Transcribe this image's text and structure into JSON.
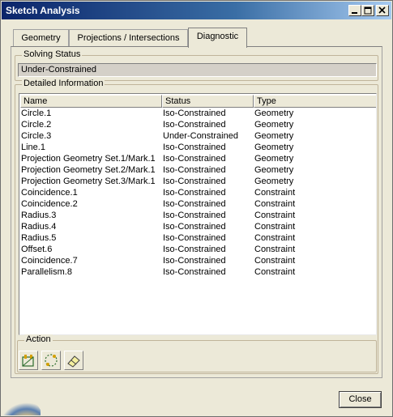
{
  "window": {
    "title": "Sketch Analysis"
  },
  "titlebar_buttons": [
    "minimize-icon",
    "maximize-icon",
    "close-icon"
  ],
  "tabs": [
    {
      "label": "Geometry"
    },
    {
      "label": "Projections / Intersections"
    },
    {
      "label": "Diagnostic"
    }
  ],
  "active_tab": "Diagnostic",
  "solving_status": {
    "label": "Solving Status",
    "value": "Under-Constrained"
  },
  "detailed_info": {
    "label": "Detailed Information",
    "columns": [
      "Name",
      "Status",
      "Type"
    ],
    "rows": [
      [
        "Circle.1",
        "Iso-Constrained",
        "Geometry"
      ],
      [
        "Circle.2",
        "Iso-Constrained",
        "Geometry"
      ],
      [
        "Circle.3",
        "Under-Constrained",
        "Geometry"
      ],
      [
        "Line.1",
        "Iso-Constrained",
        "Geometry"
      ],
      [
        "Projection Geometry Set.1/Mark.1",
        "Iso-Constrained",
        "Geometry"
      ],
      [
        "Projection Geometry Set.2/Mark.1",
        "Iso-Constrained",
        "Geometry"
      ],
      [
        "Projection Geometry Set.3/Mark.1",
        "Iso-Constrained",
        "Geometry"
      ],
      [
        "Coincidence.1",
        "Iso-Constrained",
        "Constraint"
      ],
      [
        "Coincidence.2",
        "Iso-Constrained",
        "Constraint"
      ],
      [
        "Radius.3",
        "Iso-Constrained",
        "Constraint"
      ],
      [
        "Radius.4",
        "Iso-Constrained",
        "Constraint"
      ],
      [
        "Radius.5",
        "Iso-Constrained",
        "Constraint"
      ],
      [
        "Offset.6",
        "Iso-Constrained",
        "Constraint"
      ],
      [
        "Coincidence.7",
        "Iso-Constrained",
        "Constraint"
      ],
      [
        "Parallelism.8",
        "Iso-Constrained",
        "Constraint"
      ]
    ]
  },
  "action": {
    "label": "Action",
    "buttons": [
      "fix-constraint-icon",
      "hide-geometry-icon",
      "eraser-icon"
    ]
  },
  "footer": {
    "close_label": "Close"
  },
  "colors": {
    "titlebar_start": "#0a246a",
    "titlebar_end": "#a6caf0",
    "dialog_bg": "#ece9d8"
  }
}
